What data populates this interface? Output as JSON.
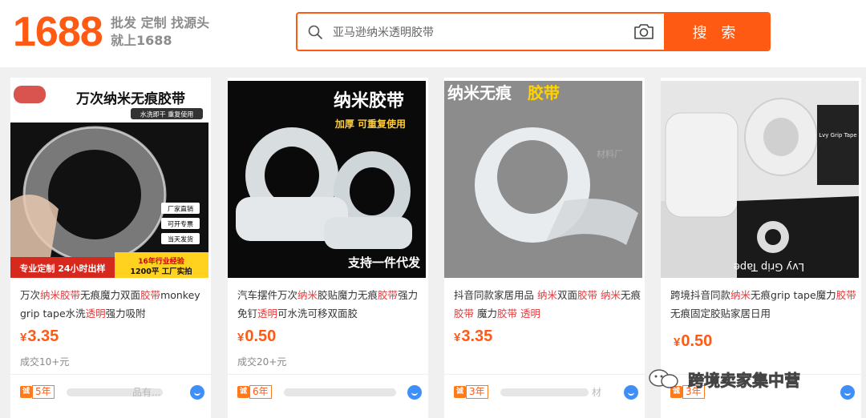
{
  "header": {
    "logo": "1688",
    "slogan_line1": "批发 定制 找源头",
    "slogan_line2": "就上1688",
    "search_value": "亚马逊纳米透明胶带",
    "search_button": "搜 索"
  },
  "brand_color": "#ff5a13",
  "highlight_color": "#e4393c",
  "products": [
    {
      "image_texts": [
        "万次纳米无痕胶带",
        "水洗即干 重复使用",
        "厂家直销",
        "可开专票",
        "当天发货",
        "专业定制 24小时出样",
        "16年行业经验",
        "1200平 工厂实拍"
      ],
      "title_segments": [
        {
          "t": "万次",
          "h": false
        },
        {
          "t": "纳米胶带",
          "h": true
        },
        {
          "t": "无痕魔力双面",
          "h": false
        },
        {
          "t": "胶带",
          "h": true
        },
        {
          "t": "monkey grip tape水洗",
          "h": false
        },
        {
          "t": "透明",
          "h": true
        },
        {
          "t": "强力吸附",
          "h": false
        }
      ],
      "price_symbol": "¥",
      "price": "3.35",
      "sold": "成交10+元",
      "badge": "诚",
      "years": "5年",
      "shop_text": "品有..."
    },
    {
      "image_texts": [
        "纳米胶带",
        "加厚 可重复使用",
        "支持一件代发"
      ],
      "title_segments": [
        {
          "t": "汽车摆件万次",
          "h": false
        },
        {
          "t": "纳米",
          "h": true
        },
        {
          "t": "胶贴魔力无痕",
          "h": false
        },
        {
          "t": "胶带",
          "h": true
        },
        {
          "t": "强力免钉",
          "h": false
        },
        {
          "t": "透明",
          "h": true
        },
        {
          "t": "可水洗可移双面胶",
          "h": false
        }
      ],
      "price_symbol": "¥",
      "price": "0.50",
      "sold": "成交20+元",
      "badge": "诚",
      "years": "6年",
      "shop_text": ""
    },
    {
      "image_texts": [
        "纳米无痕",
        "胶带",
        "材料厂"
      ],
      "title_segments": [
        {
          "t": "抖音同款家居用品 ",
          "h": false
        },
        {
          "t": "纳米",
          "h": true
        },
        {
          "t": "双面",
          "h": false
        },
        {
          "t": "胶带",
          "h": true
        },
        {
          "t": " ",
          "h": false
        },
        {
          "t": "纳米",
          "h": true
        },
        {
          "t": "无痕",
          "h": false
        },
        {
          "t": "胶带",
          "h": true
        },
        {
          "t": " 魔力",
          "h": false
        },
        {
          "t": "胶带",
          "h": true
        },
        {
          "t": " ",
          "h": false
        },
        {
          "t": "透明",
          "h": true
        }
      ],
      "price_symbol": "¥",
      "price": "3.35",
      "sold": "",
      "badge": "诚",
      "years": "3年",
      "shop_text": "材"
    },
    {
      "image_texts": [
        "Lvy Grip Tape",
        "Lvy Grip Tape"
      ],
      "title_segments": [
        {
          "t": "跨境抖音同款",
          "h": false
        },
        {
          "t": "纳米",
          "h": true
        },
        {
          "t": "无痕grip tape魔力",
          "h": false
        },
        {
          "t": "胶带",
          "h": true
        },
        {
          "t": "无痕固定胶贴家居日用",
          "h": false
        }
      ],
      "price_symbol": "¥",
      "price": "0.50",
      "sold": "",
      "badge": "诚",
      "years": "3年",
      "shop_text": ""
    }
  ],
  "watermark": "跨境卖家集中营"
}
